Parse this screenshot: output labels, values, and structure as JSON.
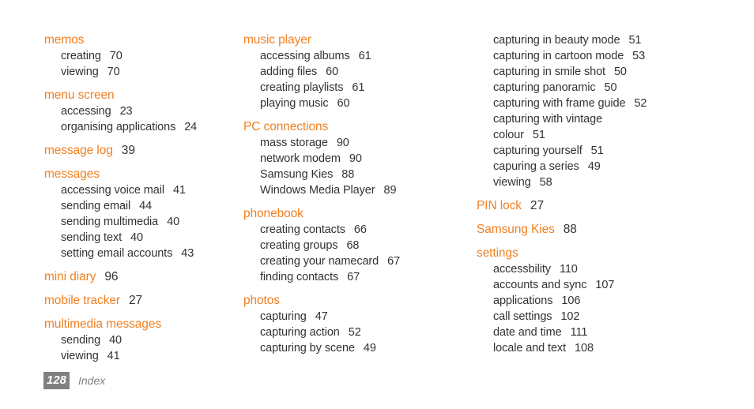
{
  "document": {
    "section": "Index",
    "page_number": "128",
    "heading_color": "#f08021",
    "body_color": "#333333",
    "footer_color": "#808080"
  },
  "columns": [
    {
      "groups": [
        {
          "heading": "memos",
          "heading_page": "",
          "entries": [
            {
              "label": "creating",
              "page": "70"
            },
            {
              "label": "viewing",
              "page": "70"
            }
          ]
        },
        {
          "heading": "menu screen",
          "heading_page": "",
          "entries": [
            {
              "label": "accessing",
              "page": "23"
            },
            {
              "label": "organising applications",
              "page": "24"
            }
          ]
        },
        {
          "heading": "message log",
          "heading_page": "39",
          "entries": []
        },
        {
          "heading": "messages",
          "heading_page": "",
          "entries": [
            {
              "label": "accessing voice mail",
              "page": "41"
            },
            {
              "label": "sending email",
              "page": "44"
            },
            {
              "label": "sending multimedia",
              "page": "40"
            },
            {
              "label": "sending text",
              "page": "40"
            },
            {
              "label": "setting email accounts",
              "page": "43"
            }
          ]
        },
        {
          "heading": "mini diary",
          "heading_page": "96",
          "entries": []
        },
        {
          "heading": "mobile tracker",
          "heading_page": "27",
          "entries": []
        },
        {
          "heading": "multimedia messages",
          "heading_page": "",
          "entries": [
            {
              "label": "sending",
              "page": "40"
            },
            {
              "label": "viewing",
              "page": "41"
            }
          ]
        }
      ]
    },
    {
      "groups": [
        {
          "heading": "music player",
          "heading_page": "",
          "entries": [
            {
              "label": "accessing albums",
              "page": "61"
            },
            {
              "label": "adding files",
              "page": "60"
            },
            {
              "label": "creating playlists",
              "page": "61"
            },
            {
              "label": "playing music",
              "page": "60"
            }
          ]
        },
        {
          "heading": "PC connections",
          "heading_page": "",
          "entries": [
            {
              "label": "mass storage",
              "page": "90"
            },
            {
              "label": "network modem",
              "page": "90"
            },
            {
              "label": "Samsung Kies",
              "page": "88"
            },
            {
              "label": "Windows Media Player",
              "page": "89"
            }
          ]
        },
        {
          "heading": "phonebook",
          "heading_page": "",
          "entries": [
            {
              "label": "creating contacts",
              "page": "66"
            },
            {
              "label": "creating groups",
              "page": "68"
            },
            {
              "label": "creating your namecard",
              "page": "67"
            },
            {
              "label": "finding contacts",
              "page": "67"
            }
          ]
        },
        {
          "heading": "photos",
          "heading_page": "",
          "entries": [
            {
              "label": "capturing",
              "page": "47"
            },
            {
              "label": "capturing action",
              "page": "52"
            },
            {
              "label": "capturing by scene",
              "page": "49"
            }
          ]
        }
      ]
    },
    {
      "continued_entries": [
        {
          "label": "capturing in beauty mode",
          "page": "51"
        },
        {
          "label": "capturing in cartoon mode",
          "page": "53"
        },
        {
          "label": "capturing in smile shot",
          "page": "50"
        },
        {
          "label": "capturing panoramic",
          "page": "50"
        },
        {
          "label": "capturing with frame guide",
          "page": "52"
        },
        {
          "label": "capturing with vintage",
          "page": ""
        },
        {
          "label": "colour",
          "page": "51"
        },
        {
          "label": "capturing yourself",
          "page": "51"
        },
        {
          "label": "capuring a series",
          "page": "49"
        },
        {
          "label": "viewing",
          "page": "58"
        }
      ],
      "groups": [
        {
          "heading": "PIN lock",
          "heading_page": "27",
          "entries": []
        },
        {
          "heading": "Samsung Kies",
          "heading_page": "88",
          "entries": []
        },
        {
          "heading": "settings",
          "heading_page": "",
          "entries": [
            {
              "label": "accessbility",
              "page": "110"
            },
            {
              "label": "accounts and sync",
              "page": "107"
            },
            {
              "label": "applications",
              "page": "106"
            },
            {
              "label": "call settings",
              "page": "102"
            },
            {
              "label": "date and time",
              "page": "111"
            },
            {
              "label": "locale and text",
              "page": "108"
            }
          ]
        }
      ]
    }
  ]
}
